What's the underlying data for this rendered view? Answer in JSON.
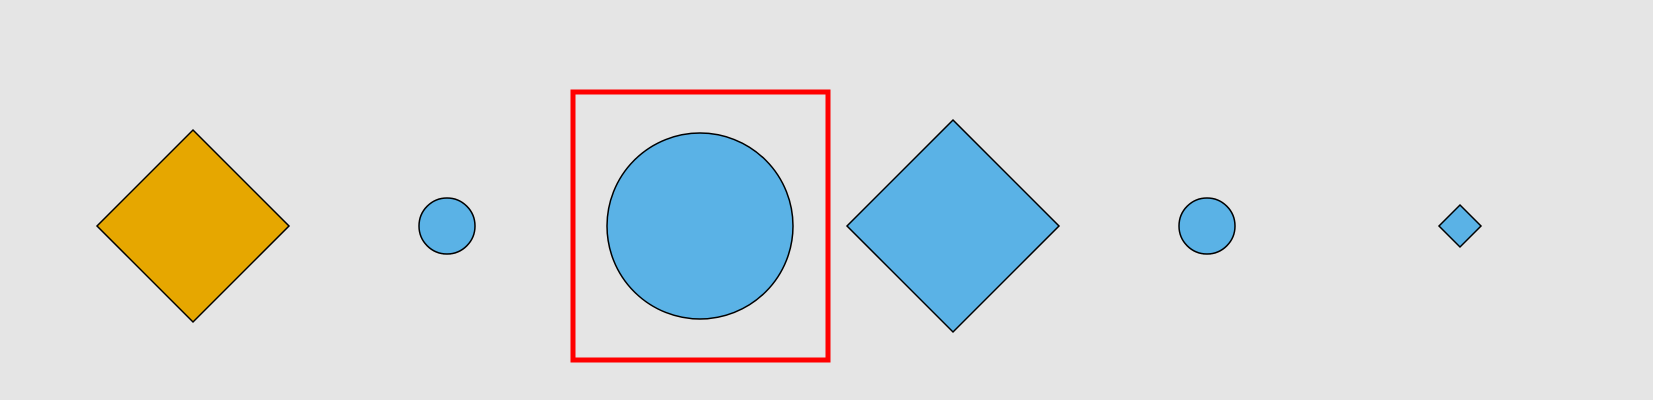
{
  "colors": {
    "background": "#e5e5e5",
    "orange": "#e6a700",
    "blue": "#5ab2e6",
    "outline": "#000000",
    "highlight": "#ff0000"
  },
  "shapes": [
    {
      "name": "orange-diamond",
      "kind": "diamond",
      "color": "orange"
    },
    {
      "name": "small-blue-circle-1",
      "kind": "circle",
      "color": "blue"
    },
    {
      "name": "large-blue-circle",
      "kind": "circle",
      "color": "blue",
      "highlighted": true
    },
    {
      "name": "large-blue-diamond",
      "kind": "diamond",
      "color": "blue"
    },
    {
      "name": "small-blue-circle-2",
      "kind": "circle",
      "color": "blue"
    },
    {
      "name": "tiny-blue-diamond",
      "kind": "diamond",
      "color": "blue"
    }
  ]
}
